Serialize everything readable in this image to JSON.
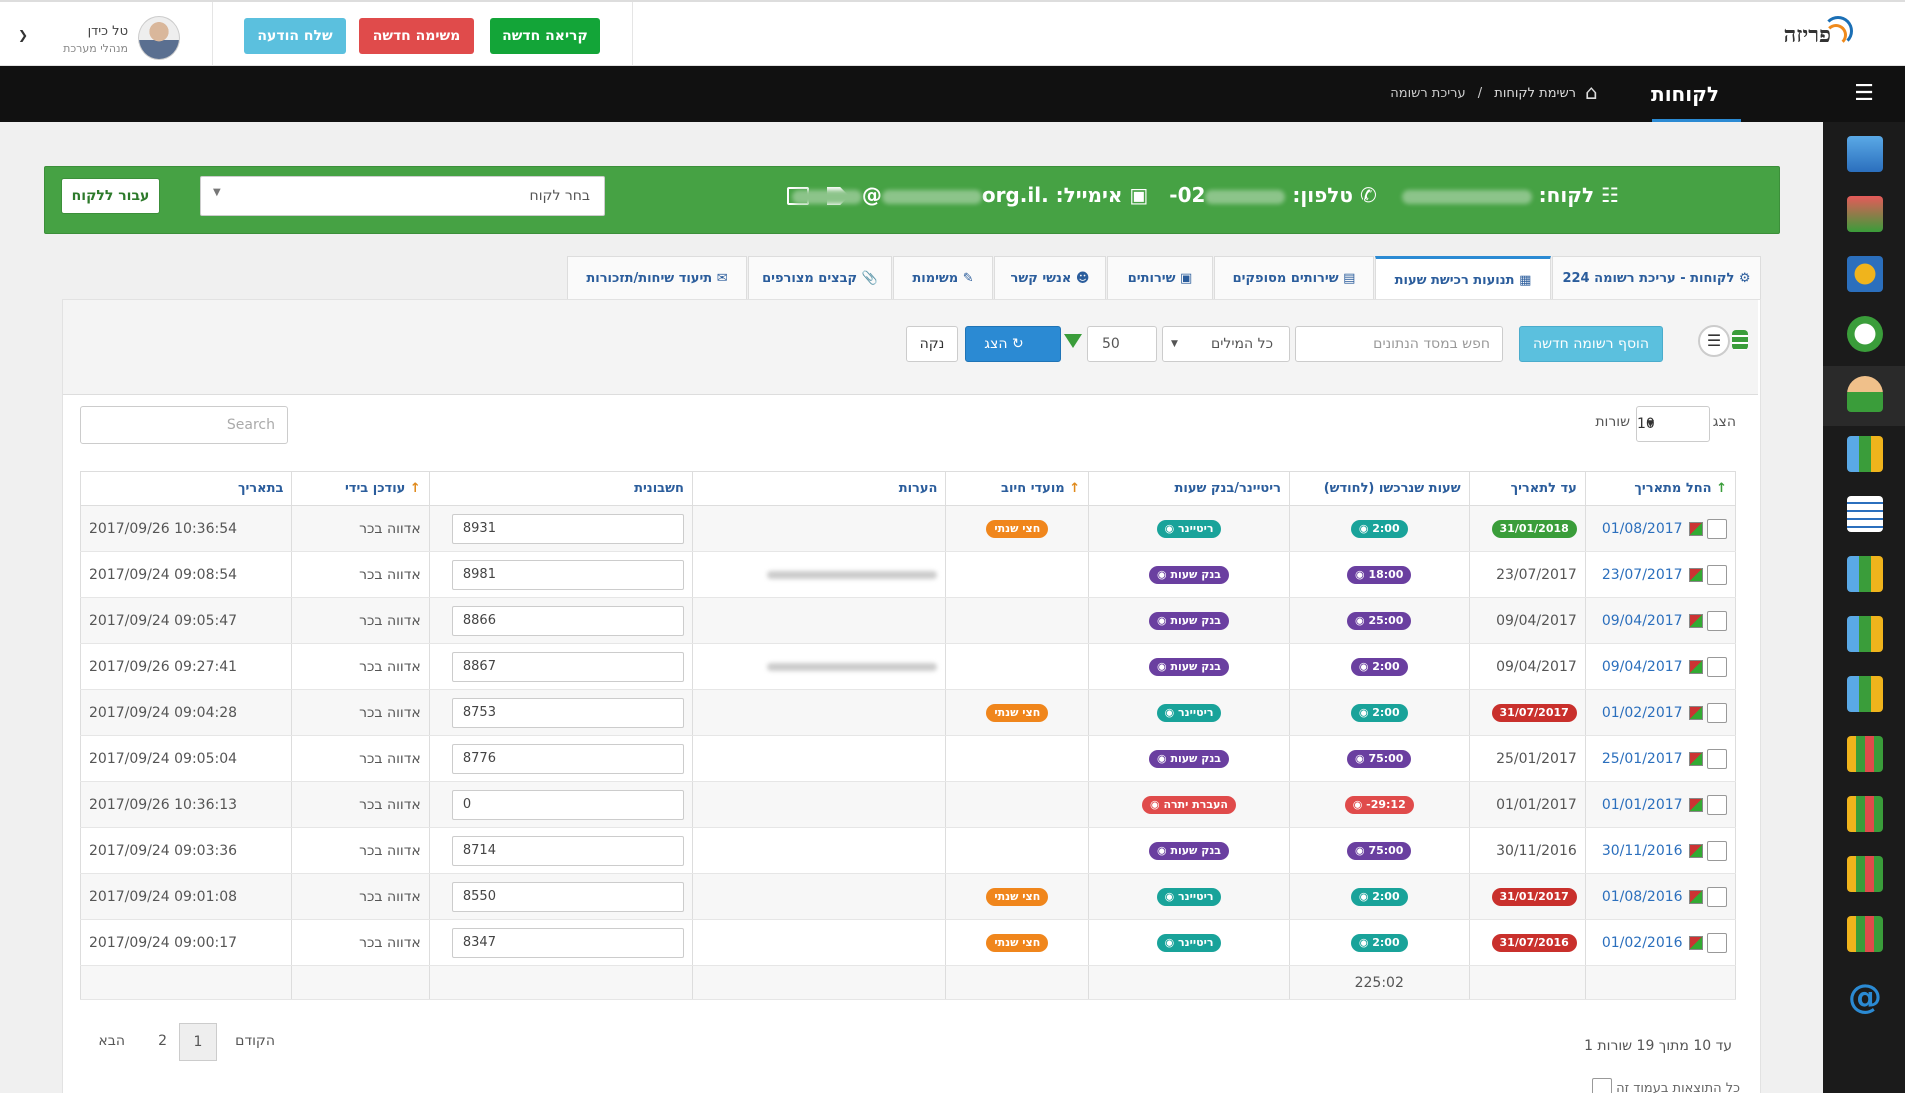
{
  "header": {
    "logo_text": "פריזה",
    "buttons": {
      "new_call": "קריאה חדשה",
      "new_task": "משימה חדשה",
      "send_message": "שלח הודעה"
    },
    "colors": {
      "new_call": "#13a538",
      "new_task": "#e04b4b",
      "send_message": "#5bc0de"
    },
    "user": {
      "name": "טל כידן",
      "role": "מנהלי מערכת"
    }
  },
  "navbar": {
    "title": "לקוחות",
    "breadcrumb": [
      "רשימת לקוחות",
      "/",
      "עריכת רשומה"
    ]
  },
  "customer_bar": {
    "customer_label": "לקוח:",
    "phone_label": "טלפון:",
    "phone_prefix": "02-",
    "email_label": "אימייל:",
    "email_visible": "@",
    "email_domain": ".org.il",
    "select_placeholder": "בחר לקוח",
    "goto_button": "עבור ללקוח"
  },
  "tabs": [
    "לקוחות - עריכת רשומה 224",
    "תנועות רכישת שעות",
    "שירותים מסופקים",
    "שירותים",
    "אנשי קשר",
    "משימות",
    "קבצים מצורפים",
    "תיעוד שיחות/תזכורות"
  ],
  "toolbar": {
    "add_button": "הוסף רשומה חדשה",
    "search_placeholder": "חפש במסד הנתונים",
    "word_mode": "כל המילים",
    "count": "50",
    "show_button": "הצג",
    "clear_button": "נקה"
  },
  "table_controls": {
    "show_label": "הצג",
    "rows_value": "10",
    "rows_label": "שורות",
    "search_placeholder": "Search"
  },
  "columns": [
    "החל מתאריך",
    "עד לתאריך",
    "שעות שנרכשו (לחודש)",
    "ריטיינר/בנק שעות",
    "מועדי חיוב",
    "הערות",
    "חשבונית",
    "עודכן בידי",
    "בתאריך"
  ],
  "rows": [
    {
      "from": "01/08/2017",
      "to": "31/01/2018",
      "to_color": "#3a9d3a",
      "hours": "2:00",
      "hours_color": "#19a39a",
      "type": "ריטיינר",
      "type_color": "#19a39a",
      "billing": "חצי שנתי",
      "notes": "",
      "invoice": "8931",
      "by": "אדווה בכר",
      "date": "2017/09/26 10:36:54"
    },
    {
      "from": "23/07/2017",
      "to": "23/07/2017",
      "to_color": "",
      "hours": "18:00",
      "hours_color": "#6a3fa0",
      "type": "בנק שעות",
      "type_color": "#6a3fa0",
      "billing": "",
      "notes": "blurred",
      "invoice": "8981",
      "by": "אדווה בכר",
      "date": "2017/09/24 09:08:54"
    },
    {
      "from": "09/04/2017",
      "to": "09/04/2017",
      "to_color": "",
      "hours": "25:00",
      "hours_color": "#6a3fa0",
      "type": "בנק שעות",
      "type_color": "#6a3fa0",
      "billing": "",
      "notes": "",
      "invoice": "8866",
      "by": "אדווה בכר",
      "date": "2017/09/24 09:05:47"
    },
    {
      "from": "09/04/2017",
      "to": "09/04/2017",
      "to_color": "",
      "hours": "2:00",
      "hours_color": "#6a3fa0",
      "type": "בנק שעות",
      "type_color": "#6a3fa0",
      "billing": "",
      "notes": "blurred",
      "invoice": "8867",
      "by": "אדווה בכר",
      "date": "2017/09/26 09:27:41"
    },
    {
      "from": "01/02/2017",
      "to": "31/07/2017",
      "to_color": "#c9302c",
      "hours": "2:00",
      "hours_color": "#19a39a",
      "type": "ריטיינר",
      "type_color": "#19a39a",
      "billing": "חצי שנתי",
      "notes": "",
      "invoice": "8753",
      "by": "אדווה בכר",
      "date": "2017/09/24 09:04:28"
    },
    {
      "from": "25/01/2017",
      "to": "25/01/2017",
      "to_color": "",
      "hours": "75:00",
      "hours_color": "#6a3fa0",
      "type": "בנק שעות",
      "type_color": "#6a3fa0",
      "billing": "",
      "notes": "",
      "invoice": "8776",
      "by": "אדווה בכר",
      "date": "2017/09/24 09:05:04"
    },
    {
      "from": "01/01/2017",
      "to": "01/01/2017",
      "to_color": "",
      "hours": "29:12-",
      "hours_color": "#e04b4b",
      "type": "העברת יתרה",
      "type_color": "#e04b4b",
      "billing": "",
      "notes": "",
      "invoice": "0",
      "by": "אדווה בכר",
      "date": "2017/09/26 10:36:13"
    },
    {
      "from": "30/11/2016",
      "to": "30/11/2016",
      "to_color": "",
      "hours": "75:00",
      "hours_color": "#6a3fa0",
      "type": "בנק שעות",
      "type_color": "#6a3fa0",
      "billing": "",
      "notes": "",
      "invoice": "8714",
      "by": "אדווה בכר",
      "date": "2017/09/24 09:03:36"
    },
    {
      "from": "01/08/2016",
      "to": "31/01/2017",
      "to_color": "#c9302c",
      "hours": "2:00",
      "hours_color": "#19a39a",
      "type": "ריטיינר",
      "type_color": "#19a39a",
      "billing": "חצי שנתי",
      "notes": "",
      "invoice": "8550",
      "by": "אדווה בכר",
      "date": "2017/09/24 09:01:08"
    },
    {
      "from": "01/02/2016",
      "to": "31/07/2016",
      "to_color": "#c9302c",
      "hours": "2:00",
      "hours_color": "#19a39a",
      "type": "ריטיינר",
      "type_color": "#19a39a",
      "billing": "חצי שנתי",
      "notes": "",
      "invoice": "8347",
      "by": "אדווה בכר",
      "date": "2017/09/24 09:00:17"
    }
  ],
  "total_hours": "225:02",
  "billing_color": "#f0861c",
  "pagination": {
    "info": "1 עד 10 מתוך 19 שורות",
    "prev": "הקודם",
    "pages": [
      "1",
      "2"
    ],
    "next": "הבא"
  },
  "select_all_label": "כל התוצאות בעמוד זה"
}
